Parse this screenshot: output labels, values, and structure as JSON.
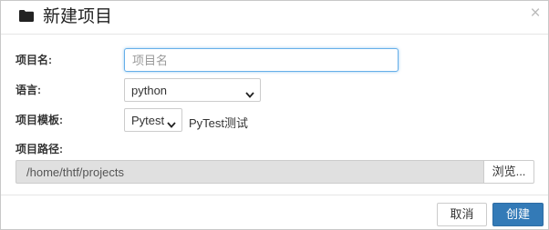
{
  "dialog": {
    "title": "新建项目",
    "close_glyph": "×",
    "header_icon": "folder-icon",
    "accent_color": "#337ab7"
  },
  "form": {
    "name": {
      "label": "项目名:",
      "value": "",
      "placeholder": "项目名"
    },
    "language": {
      "label": "语言:",
      "selected": "python"
    },
    "template": {
      "label": "项目模板:",
      "selected": "Pytest",
      "description": "PyTest测试"
    },
    "path": {
      "label": "项目路径:",
      "value": "/home/thtf/projects",
      "browse_label": "浏览..."
    }
  },
  "footer": {
    "cancel_label": "取消",
    "create_label": "创建"
  }
}
